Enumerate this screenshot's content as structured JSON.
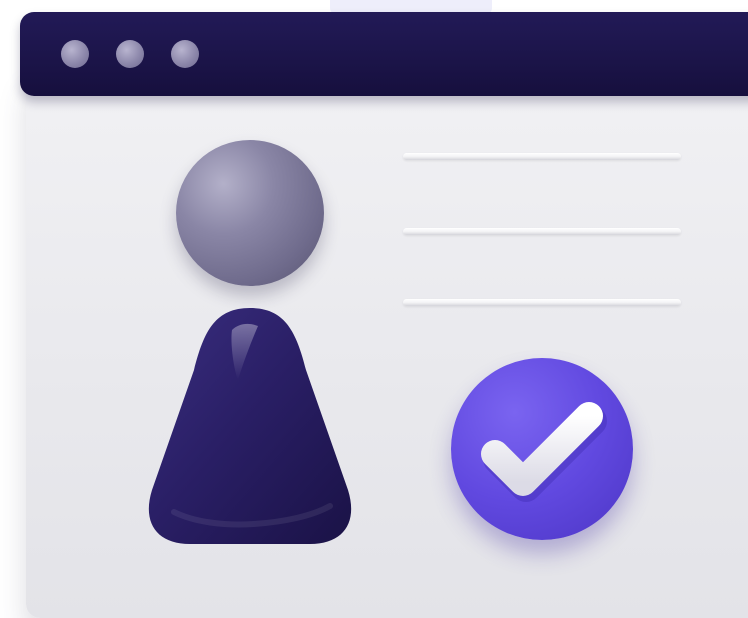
{
  "window": {
    "titlebar_color": "#1b1448",
    "body_color": "#ececf0",
    "controls": [
      {
        "name": "window-control-dot-1"
      },
      {
        "name": "window-control-dot-2"
      },
      {
        "name": "window-control-dot-3"
      }
    ]
  },
  "profile": {
    "head_color": "#8a86a6",
    "body_color": "#2a1f66",
    "text_lines_count": 3
  },
  "badge": {
    "icon": "checkmark-icon",
    "color": "#6149e0",
    "check_color": "#f3f2f7"
  }
}
